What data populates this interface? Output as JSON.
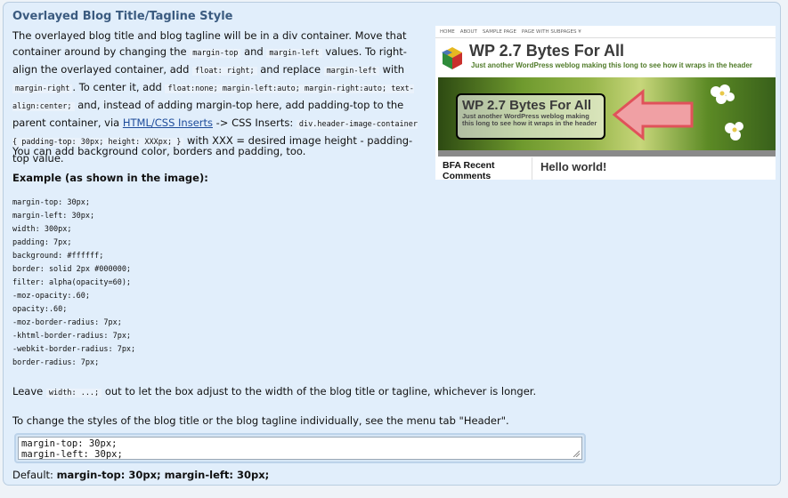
{
  "section": {
    "title": "Overlayed Blog Title/Tagline Style"
  },
  "intro": {
    "t1": "The overlayed blog title and blog tagline will be in a div container. Move that container around by changing the",
    "c1": "margin-top",
    "t2": "and",
    "c2": "margin-left",
    "t3": "values. To right-align the overlayed container, add",
    "c3": "float: right;",
    "t4": "and replace",
    "c4": "margin-left",
    "t5": "with",
    "c5": "margin-right",
    "t6": ". To center it, add",
    "c6": "float:none; margin-left:auto; margin-right:auto; text-align:center;",
    "t7": "and, instead of adding margin-top here, add padding-top to the parent container, via",
    "link": "HTML/CSS Inserts",
    "t8": "-> CSS Inserts:",
    "c7": "div.header-image-container { padding-top: 30px; height: XXXpx; }",
    "t9": "with XXX = desired image height - padding-top value."
  },
  "background_note": "You can add background color, borders and padding, too.",
  "example_title": "Example (as shown in the image):",
  "example_css": [
    "margin-top: 30px;",
    "margin-left: 30px;",
    "width: 300px;",
    "padding: 7px;",
    "background: #ffffff;",
    "border: solid 2px #000000;",
    "filter: alpha(opacity=60);",
    "-moz-opacity:.60;",
    "opacity:.60;",
    "-moz-border-radius: 7px;",
    "-khtml-border-radius: 7px;",
    "-webkit-border-radius: 7px;",
    "border-radius: 7px;"
  ],
  "leave": {
    "t1": "Leave",
    "c1": "width: ...;",
    "t2": "out to let the box adjust to the width of the blog title or tagline, whichever is longer."
  },
  "change_note": "To change the styles of the blog title or the blog tagline individually, see the menu tab \"Header\".",
  "textarea": {
    "lines": [
      "margin-top: 30px;",
      "margin-left: 30px;"
    ]
  },
  "default": {
    "label": "Default:",
    "value": "margin-top: 30px; margin-left: 30px;"
  },
  "preview": {
    "nav": [
      "HOME",
      "ABOUT",
      "SAMPLE PAGE",
      "PAGE WITH SUBPAGES ¥"
    ],
    "blog_title": "WP 2.7 Bytes For All",
    "blog_tagline": "Just another WordPress weblog making this long to see how it wraps in the header",
    "overlay_title": "WP 2.7 Bytes For All",
    "overlay_tagline": "Just another WordPress weblog making this long to see how it wraps in the header",
    "sidebar_title": "BFA Recent Comments",
    "post_title": "Hello world!"
  },
  "colors": {
    "panel_bg": "#e1eefb",
    "title": "#3b5b80",
    "link": "#1d4b9a",
    "arrow": "#e0525a"
  }
}
